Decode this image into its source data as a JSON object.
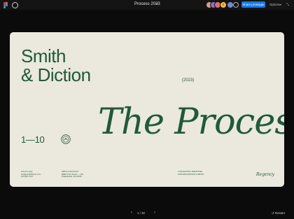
{
  "topbar": {
    "title": "Process 2023",
    "share_label": "Share prototype",
    "options_label": "Options",
    "avatar_colors": [
      "#d8a07a",
      "#8c6ad6",
      "#f0c040",
      "#e07060",
      "#6a8cd6"
    ],
    "avatar_badge": "S"
  },
  "slide": {
    "brand_line1": "Smith",
    "brand_line2": "& Diction",
    "year": "(2023)",
    "range": "1—10",
    "headline": "The Process",
    "footer": {
      "col1": [
        "Proud to play",
        "info@smithdiction.com",
        "215.681.7447"
      ],
      "col2": [
        "SMITH & DICTION",
        "8680 N 3rd Street — 201",
        "Philadelphia, PA 19106"
      ],
      "col3": [
        "THOUGHTFUL IDENTITIES",
        "FOR IMAGINATIVE CLIENTS"
      ],
      "signature": "Regency"
    }
  },
  "controls": {
    "page": "1 / 30",
    "prev_icon": "chevron-left",
    "next_icon": "chevron-right",
    "restart_label": "Restart"
  },
  "colors": {
    "accent": "#1f5a3a",
    "slide_bg": "#ebe8de",
    "app_bg": "#0b0b0b",
    "primary_button": "#1479e8"
  }
}
